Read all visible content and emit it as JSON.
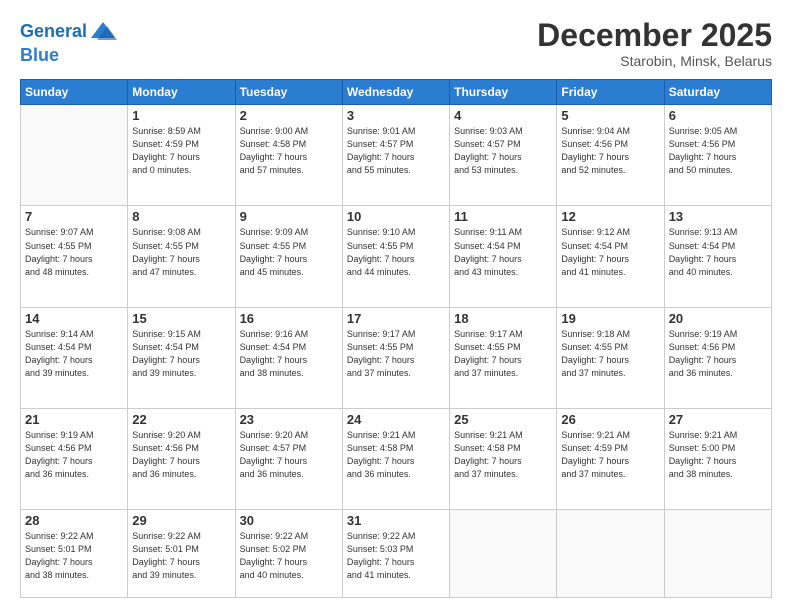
{
  "header": {
    "logo_line1": "General",
    "logo_line2": "Blue",
    "month": "December 2025",
    "location": "Starobin, Minsk, Belarus"
  },
  "weekdays": [
    "Sunday",
    "Monday",
    "Tuesday",
    "Wednesday",
    "Thursday",
    "Friday",
    "Saturday"
  ],
  "weeks": [
    [
      {
        "day": "",
        "info": ""
      },
      {
        "day": "1",
        "info": "Sunrise: 8:59 AM\nSunset: 4:59 PM\nDaylight: 7 hours\nand 0 minutes."
      },
      {
        "day": "2",
        "info": "Sunrise: 9:00 AM\nSunset: 4:58 PM\nDaylight: 7 hours\nand 57 minutes."
      },
      {
        "day": "3",
        "info": "Sunrise: 9:01 AM\nSunset: 4:57 PM\nDaylight: 7 hours\nand 55 minutes."
      },
      {
        "day": "4",
        "info": "Sunrise: 9:03 AM\nSunset: 4:57 PM\nDaylight: 7 hours\nand 53 minutes."
      },
      {
        "day": "5",
        "info": "Sunrise: 9:04 AM\nSunset: 4:56 PM\nDaylight: 7 hours\nand 52 minutes."
      },
      {
        "day": "6",
        "info": "Sunrise: 9:05 AM\nSunset: 4:56 PM\nDaylight: 7 hours\nand 50 minutes."
      }
    ],
    [
      {
        "day": "7",
        "info": "Sunrise: 9:07 AM\nSunset: 4:55 PM\nDaylight: 7 hours\nand 48 minutes."
      },
      {
        "day": "8",
        "info": "Sunrise: 9:08 AM\nSunset: 4:55 PM\nDaylight: 7 hours\nand 47 minutes."
      },
      {
        "day": "9",
        "info": "Sunrise: 9:09 AM\nSunset: 4:55 PM\nDaylight: 7 hours\nand 45 minutes."
      },
      {
        "day": "10",
        "info": "Sunrise: 9:10 AM\nSunset: 4:55 PM\nDaylight: 7 hours\nand 44 minutes."
      },
      {
        "day": "11",
        "info": "Sunrise: 9:11 AM\nSunset: 4:54 PM\nDaylight: 7 hours\nand 43 minutes."
      },
      {
        "day": "12",
        "info": "Sunrise: 9:12 AM\nSunset: 4:54 PM\nDaylight: 7 hours\nand 41 minutes."
      },
      {
        "day": "13",
        "info": "Sunrise: 9:13 AM\nSunset: 4:54 PM\nDaylight: 7 hours\nand 40 minutes."
      }
    ],
    [
      {
        "day": "14",
        "info": "Sunrise: 9:14 AM\nSunset: 4:54 PM\nDaylight: 7 hours\nand 39 minutes."
      },
      {
        "day": "15",
        "info": "Sunrise: 9:15 AM\nSunset: 4:54 PM\nDaylight: 7 hours\nand 39 minutes."
      },
      {
        "day": "16",
        "info": "Sunrise: 9:16 AM\nSunset: 4:54 PM\nDaylight: 7 hours\nand 38 minutes."
      },
      {
        "day": "17",
        "info": "Sunrise: 9:17 AM\nSunset: 4:55 PM\nDaylight: 7 hours\nand 37 minutes."
      },
      {
        "day": "18",
        "info": "Sunrise: 9:17 AM\nSunset: 4:55 PM\nDaylight: 7 hours\nand 37 minutes."
      },
      {
        "day": "19",
        "info": "Sunrise: 9:18 AM\nSunset: 4:55 PM\nDaylight: 7 hours\nand 37 minutes."
      },
      {
        "day": "20",
        "info": "Sunrise: 9:19 AM\nSunset: 4:56 PM\nDaylight: 7 hours\nand 36 minutes."
      }
    ],
    [
      {
        "day": "21",
        "info": "Sunrise: 9:19 AM\nSunset: 4:56 PM\nDaylight: 7 hours\nand 36 minutes."
      },
      {
        "day": "22",
        "info": "Sunrise: 9:20 AM\nSunset: 4:56 PM\nDaylight: 7 hours\nand 36 minutes."
      },
      {
        "day": "23",
        "info": "Sunrise: 9:20 AM\nSunset: 4:57 PM\nDaylight: 7 hours\nand 36 minutes."
      },
      {
        "day": "24",
        "info": "Sunrise: 9:21 AM\nSunset: 4:58 PM\nDaylight: 7 hours\nand 36 minutes."
      },
      {
        "day": "25",
        "info": "Sunrise: 9:21 AM\nSunset: 4:58 PM\nDaylight: 7 hours\nand 37 minutes."
      },
      {
        "day": "26",
        "info": "Sunrise: 9:21 AM\nSunset: 4:59 PM\nDaylight: 7 hours\nand 37 minutes."
      },
      {
        "day": "27",
        "info": "Sunrise: 9:21 AM\nSunset: 5:00 PM\nDaylight: 7 hours\nand 38 minutes."
      }
    ],
    [
      {
        "day": "28",
        "info": "Sunrise: 9:22 AM\nSunset: 5:01 PM\nDaylight: 7 hours\nand 38 minutes."
      },
      {
        "day": "29",
        "info": "Sunrise: 9:22 AM\nSunset: 5:01 PM\nDaylight: 7 hours\nand 39 minutes."
      },
      {
        "day": "30",
        "info": "Sunrise: 9:22 AM\nSunset: 5:02 PM\nDaylight: 7 hours\nand 40 minutes."
      },
      {
        "day": "31",
        "info": "Sunrise: 9:22 AM\nSunset: 5:03 PM\nDaylight: 7 hours\nand 41 minutes."
      },
      {
        "day": "",
        "info": ""
      },
      {
        "day": "",
        "info": ""
      },
      {
        "day": "",
        "info": ""
      }
    ]
  ]
}
